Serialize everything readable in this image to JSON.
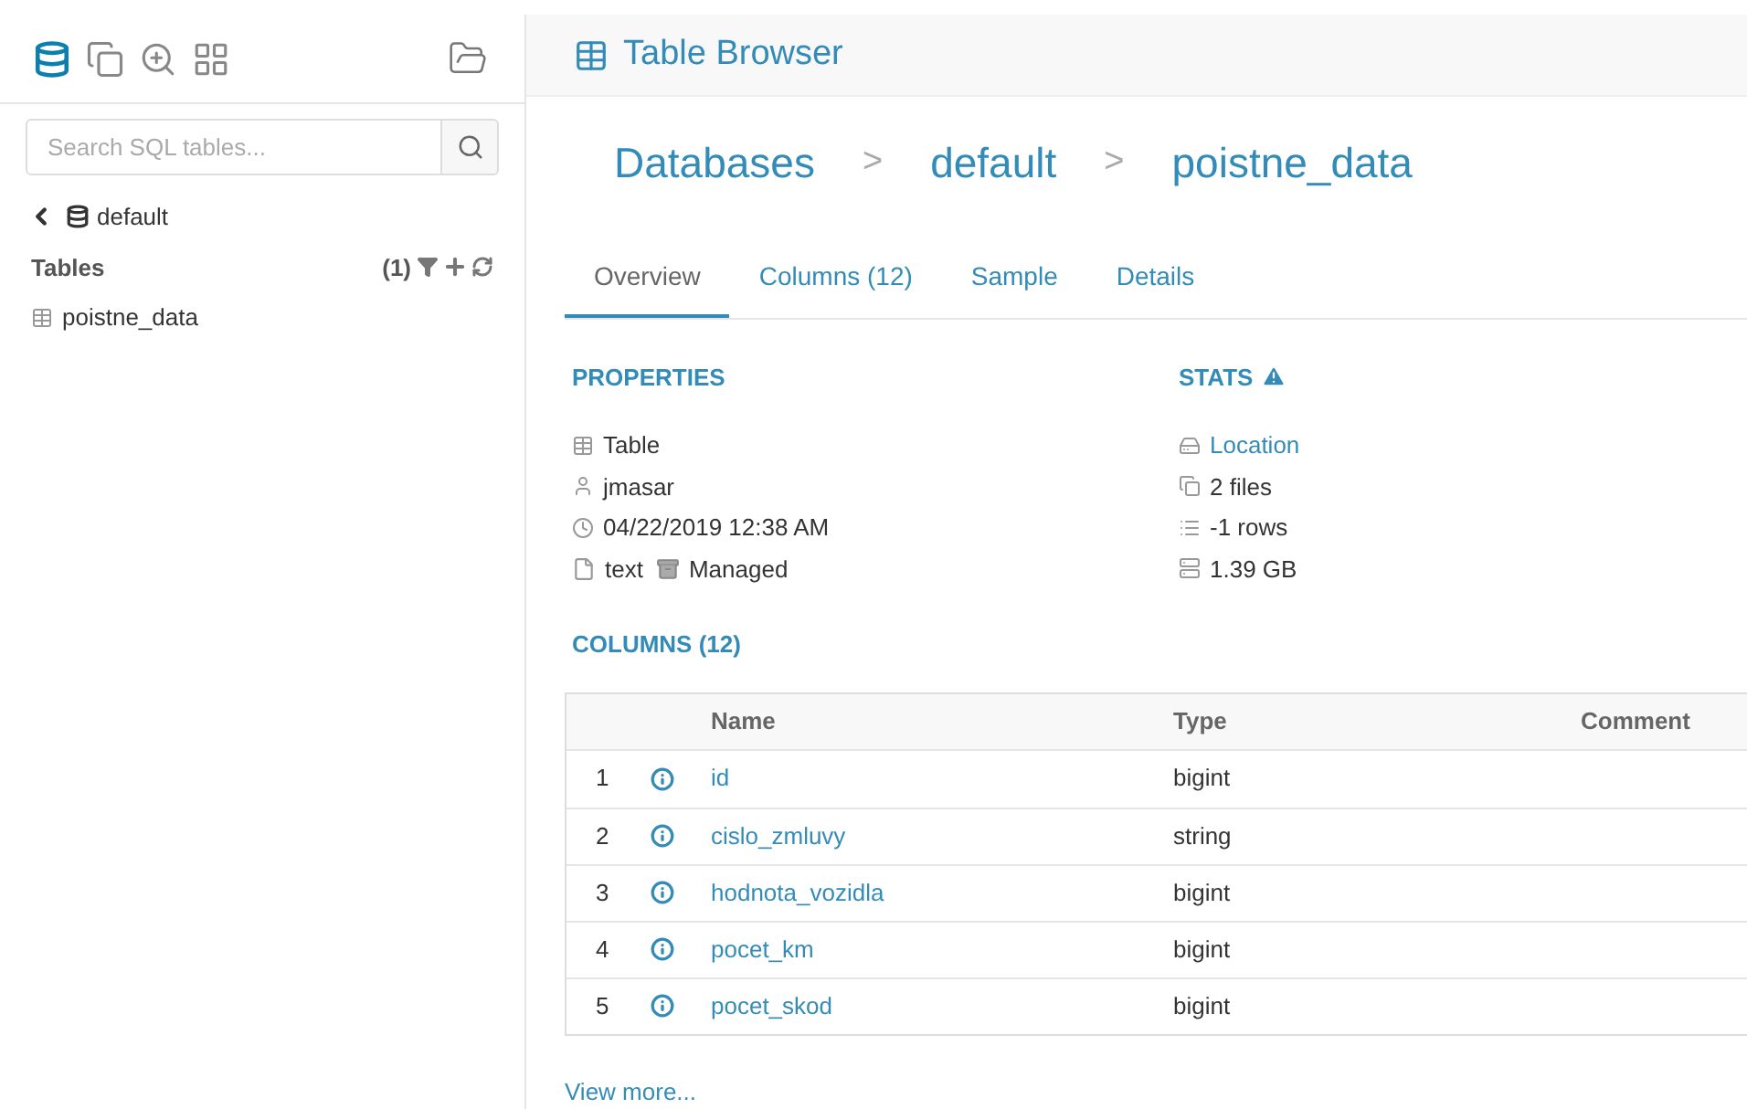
{
  "sidebar": {
    "nav_icons": [
      {
        "kind": "database",
        "selected": true
      },
      {
        "kind": "files",
        "selected": false
      },
      {
        "kind": "zoom",
        "selected": false
      },
      {
        "kind": "grid",
        "selected": false
      }
    ],
    "search": {
      "placeholder": "Search SQL tables..."
    },
    "database": "default",
    "tables_label": "Tables",
    "tables_count": "(1)",
    "tables": [
      {
        "name": "poistne_data"
      }
    ]
  },
  "header": {
    "title": "Table Browser"
  },
  "breadcrumb": [
    {
      "label": "Databases"
    },
    {
      "label": "default"
    },
    {
      "label": "poistne_data"
    }
  ],
  "breadcrumb_separator": ">",
  "tabs": [
    {
      "label": "Overview",
      "selected": true
    },
    {
      "label": "Columns (12)",
      "selected": false
    },
    {
      "label": "Sample",
      "selected": false
    },
    {
      "label": "Details",
      "selected": false
    }
  ],
  "properties": {
    "title": "PROPERTIES",
    "items": [
      {
        "kind": "table",
        "text": "Table"
      },
      {
        "kind": "user",
        "text": "jmasar"
      },
      {
        "kind": "clock",
        "text": "04/22/2019 12:38 AM"
      }
    ],
    "format": "text",
    "managed": "Managed"
  },
  "stats": {
    "title": "STATS",
    "items": [
      {
        "kind": "location",
        "text": "Location",
        "link": true
      },
      {
        "kind": "files",
        "text": "2 files",
        "link": false
      },
      {
        "kind": "rows",
        "text": "-1 rows",
        "link": false
      },
      {
        "kind": "size",
        "text": "1.39 GB",
        "link": false
      }
    ]
  },
  "columns": {
    "title": "COLUMNS (12)",
    "headers": [
      "Name",
      "Type",
      "Comment"
    ],
    "rows": [
      {
        "index": "1",
        "name": "id",
        "type": "bigint"
      },
      {
        "index": "2",
        "name": "cislo_zmluvy",
        "type": "string"
      },
      {
        "index": "3",
        "name": "hodnota_vozidla",
        "type": "bigint"
      },
      {
        "index": "4",
        "name": "pocet_km",
        "type": "bigint"
      },
      {
        "index": "5",
        "name": "pocet_skod",
        "type": "bigint"
      }
    ],
    "view_more": "View more..."
  }
}
